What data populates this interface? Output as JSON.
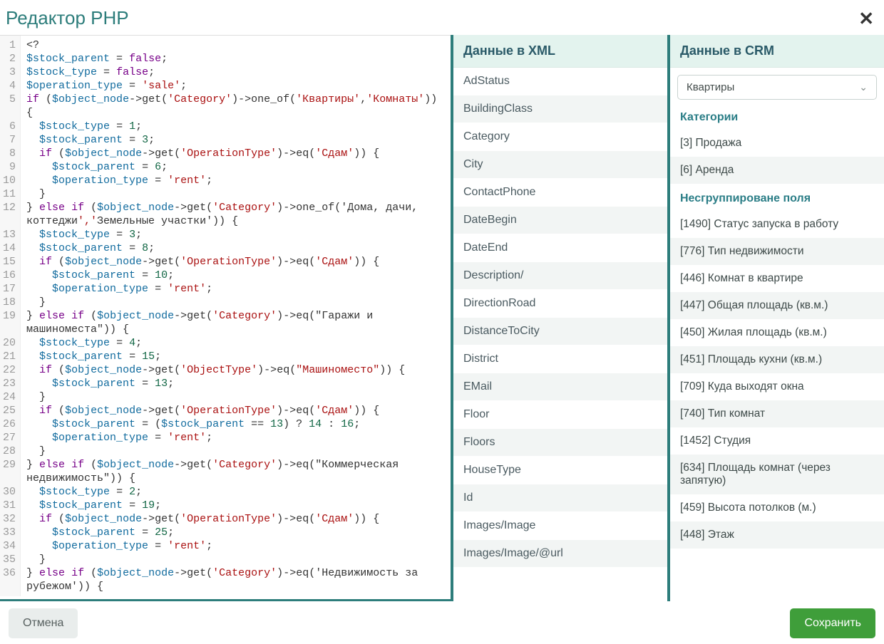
{
  "title": "Редактор PHP",
  "close_glyph": "✕",
  "footer": {
    "cancel": "Отмена",
    "save": "Сохранить"
  },
  "code_lines": [
    {
      "n": "1",
      "t": "<?"
    },
    {
      "n": "2",
      "t": "$stock_parent = false;"
    },
    {
      "n": "3",
      "t": "$stock_type = false;"
    },
    {
      "n": "4",
      "t": "$operation_type = 'sale';"
    },
    {
      "n": "5",
      "t": "if ($object_node->get('Category')->one_of('Квартиры','Комнаты'))\n{"
    },
    {
      "n": "6",
      "t": "  $stock_type = 1;"
    },
    {
      "n": "7",
      "t": "  $stock_parent = 3;"
    },
    {
      "n": "8",
      "t": "  if ($object_node->get('OperationType')->eq('Сдам')) {"
    },
    {
      "n": "9",
      "t": "    $stock_parent = 6;"
    },
    {
      "n": "10",
      "t": "    $operation_type = 'rent';"
    },
    {
      "n": "11",
      "t": "  }"
    },
    {
      "n": "12",
      "t": "} else if ($object_node->get('Category')->one_of('Дома, дачи,\nкоттеджи','Земельные участки')) {"
    },
    {
      "n": "13",
      "t": "  $stock_type = 3;"
    },
    {
      "n": "14",
      "t": "  $stock_parent = 8;"
    },
    {
      "n": "15",
      "t": "  if ($object_node->get('OperationType')->eq('Сдам')) {"
    },
    {
      "n": "16",
      "t": "    $stock_parent = 10;"
    },
    {
      "n": "17",
      "t": "    $operation_type = 'rent';"
    },
    {
      "n": "18",
      "t": "  }"
    },
    {
      "n": "19",
      "t": "} else if ($object_node->get('Category')->eq(\"Гаражи и\nмашиноместа\")) {"
    },
    {
      "n": "20",
      "t": "  $stock_type = 4;"
    },
    {
      "n": "21",
      "t": "  $stock_parent = 15;"
    },
    {
      "n": "22",
      "t": "  if ($object_node->get('ObjectType')->eq(\"Машиноместо\")) {"
    },
    {
      "n": "23",
      "t": "    $stock_parent = 13;"
    },
    {
      "n": "24",
      "t": "  }"
    },
    {
      "n": "25",
      "t": "  if ($object_node->get('OperationType')->eq('Сдам')) {"
    },
    {
      "n": "26",
      "t": "    $stock_parent = ($stock_parent == 13) ? 14 : 16;"
    },
    {
      "n": "27",
      "t": "    $operation_type = 'rent';"
    },
    {
      "n": "28",
      "t": "  }"
    },
    {
      "n": "29",
      "t": "} else if ($object_node->get('Category')->eq(\"Коммерческая\nнедвижимость\")) {"
    },
    {
      "n": "30",
      "t": "  $stock_type = 2;"
    },
    {
      "n": "31",
      "t": "  $stock_parent = 19;"
    },
    {
      "n": "32",
      "t": "  if ($object_node->get('OperationType')->eq('Сдам')) {"
    },
    {
      "n": "33",
      "t": "    $stock_parent = 25;"
    },
    {
      "n": "34",
      "t": "    $operation_type = 'rent';"
    },
    {
      "n": "35",
      "t": "  }"
    },
    {
      "n": "36",
      "t": "} else if ($object_node->get('Category')->eq('Недвижимость за\nрубежом')) {"
    }
  ],
  "xml_panel": {
    "title": "Данные в XML",
    "items": [
      "AdStatus",
      "BuildingClass",
      "Category",
      "City",
      "ContactPhone",
      "DateBegin",
      "DateEnd",
      "Description/",
      "DirectionRoad",
      "DistanceToCity",
      "District",
      "EMail",
      "Floor",
      "Floors",
      "HouseType",
      "Id",
      "Images/Image",
      "Images/Image/@url"
    ]
  },
  "crm_panel": {
    "title": "Данные в CRM",
    "select_value": "Квартиры",
    "sections": [
      {
        "heading": "Категории",
        "items": [
          "[3] Продажа",
          "[6] Аренда"
        ]
      },
      {
        "heading": "Несгруппироване поля",
        "items": [
          "[1490] Статус запуска в работу",
          "[776] Тип недвижимости",
          "[446] Комнат в квартире",
          "[447] Общая площадь (кв.м.)",
          "[450] Жилая площадь (кв.м.)",
          "[451] Площадь кухни (кв.м.)",
          "[709] Куда выходят окна",
          "[740] Тип комнат",
          "[1452] Студия",
          "[634] Площадь комнат (через запятую)",
          "[459] Высота потолков (м.)",
          "[448] Этаж"
        ]
      }
    ]
  }
}
